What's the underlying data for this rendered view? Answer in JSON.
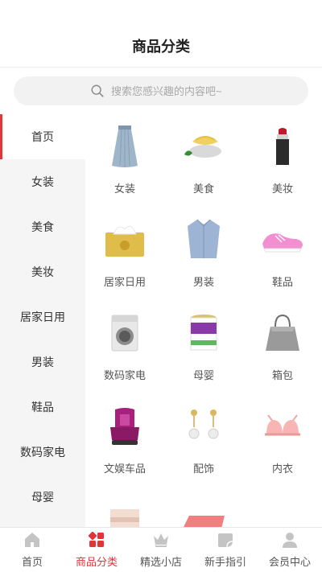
{
  "header": {
    "title": "商品分类"
  },
  "search": {
    "placeholder": "搜索您感兴趣的内容吧~"
  },
  "sidebar": {
    "items": [
      {
        "label": "首页",
        "active": true
      },
      {
        "label": "女装"
      },
      {
        "label": "美食"
      },
      {
        "label": "美妆"
      },
      {
        "label": "居家日用"
      },
      {
        "label": "男装"
      },
      {
        "label": "鞋品"
      },
      {
        "label": "数码家电"
      },
      {
        "label": "母婴"
      }
    ]
  },
  "grid": {
    "items": [
      {
        "label": "女装",
        "icon": "skirt-icon"
      },
      {
        "label": "美食",
        "icon": "snack-bowl-icon"
      },
      {
        "label": "美妆",
        "icon": "lipstick-icon"
      },
      {
        "label": "居家日用",
        "icon": "tissue-box-icon"
      },
      {
        "label": "男装",
        "icon": "shirt-icon"
      },
      {
        "label": "鞋品",
        "icon": "sneaker-icon"
      },
      {
        "label": "数码家电",
        "icon": "washing-machine-icon"
      },
      {
        "label": "母婴",
        "icon": "milk-powder-can-icon"
      },
      {
        "label": "箱包",
        "icon": "handbag-icon"
      },
      {
        "label": "文娱车品",
        "icon": "car-seat-icon"
      },
      {
        "label": "配饰",
        "icon": "earrings-icon"
      },
      {
        "label": "内衣",
        "icon": "bra-icon"
      },
      {
        "label": "",
        "icon": "bedding-icon"
      },
      {
        "label": "",
        "icon": "yoga-mat-icon"
      }
    ]
  },
  "tabbar": {
    "items": [
      {
        "label": "首页",
        "icon": "home-icon"
      },
      {
        "label": "商品分类",
        "icon": "category-icon",
        "active": true
      },
      {
        "label": "精选小店",
        "icon": "crown-icon"
      },
      {
        "label": "新手指引",
        "icon": "guide-icon"
      },
      {
        "label": "会员中心",
        "icon": "user-icon"
      }
    ]
  },
  "colors": {
    "accent": "#e2353a",
    "sidebar_bg": "#f5f5f5",
    "tab_inactive": "#c4c4c4"
  }
}
